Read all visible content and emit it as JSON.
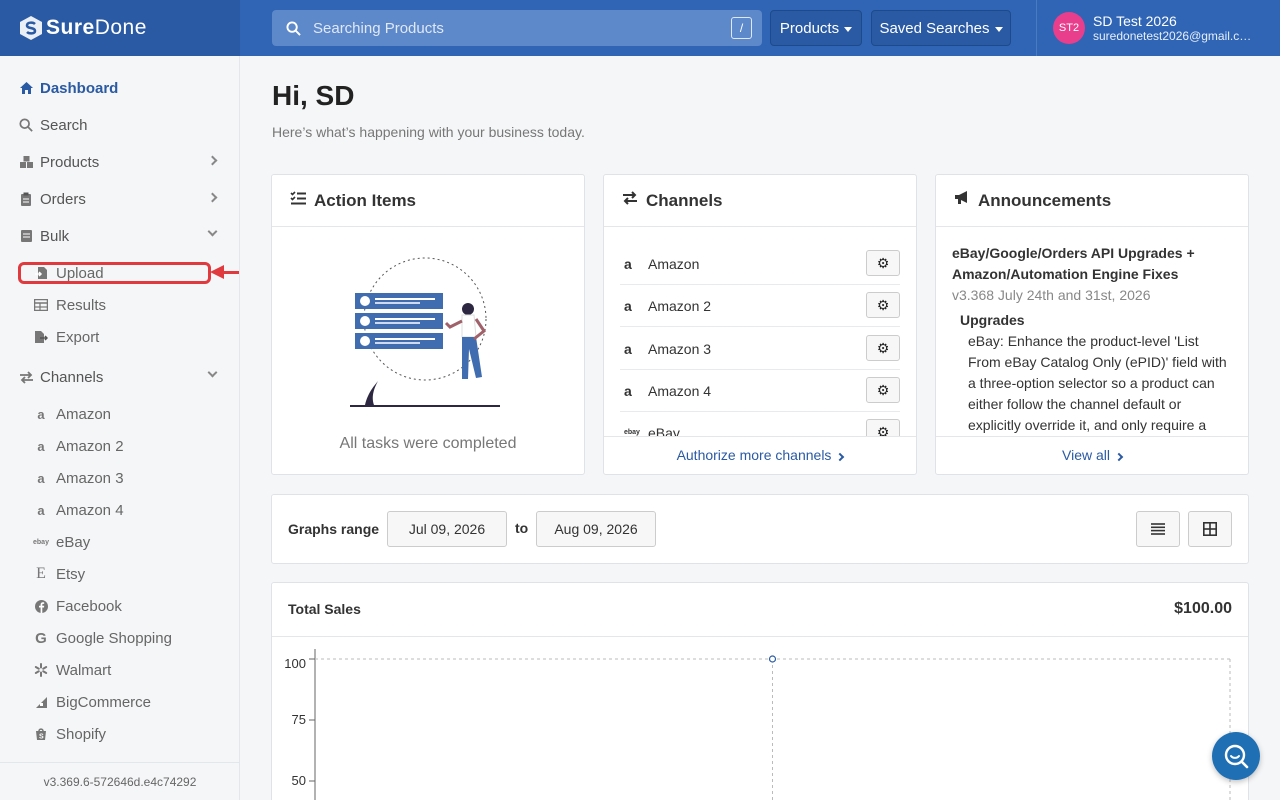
{
  "brand": {
    "name_part1": "Sure",
    "name_part2": "Done"
  },
  "header": {
    "search_placeholder": "Searching Products",
    "search_shortcut": "/",
    "products_button": "Products",
    "saved_searches_button": "Saved Searches",
    "user": {
      "initials": "ST2",
      "name": "SD Test 2026",
      "email": "suredonetest2026@gmail.com"
    }
  },
  "sidebar": {
    "items": [
      {
        "label": "Dashboard",
        "icon": "home-icon",
        "active": true
      },
      {
        "label": "Search",
        "icon": "search-icon"
      },
      {
        "label": "Products",
        "icon": "boxes-icon",
        "chevron": "right"
      },
      {
        "label": "Orders",
        "icon": "clipboard-icon",
        "chevron": "right"
      },
      {
        "label": "Bulk",
        "icon": "bulk-icon",
        "chevron": "down"
      }
    ],
    "bulk_sub": [
      {
        "label": "Upload",
        "icon": "file-import-icon"
      },
      {
        "label": "Results",
        "icon": "table-icon"
      },
      {
        "label": "Export",
        "icon": "file-export-icon"
      }
    ],
    "channels_header": {
      "label": "Channels",
      "icon": "exchange-icon",
      "chevron": "down"
    },
    "channels": [
      {
        "label": "Amazon",
        "icon": "amazon-icon"
      },
      {
        "label": "Amazon 2",
        "icon": "amazon-icon"
      },
      {
        "label": "Amazon 3",
        "icon": "amazon-icon"
      },
      {
        "label": "Amazon 4",
        "icon": "amazon-icon"
      },
      {
        "label": "eBay",
        "icon": "ebay-icon"
      },
      {
        "label": "Etsy",
        "icon": "etsy-icon"
      },
      {
        "label": "Facebook",
        "icon": "facebook-icon"
      },
      {
        "label": "Google Shopping",
        "icon": "google-icon"
      },
      {
        "label": "Walmart",
        "icon": "walmart-icon"
      },
      {
        "label": "BigCommerce",
        "icon": "bigcommerce-icon"
      },
      {
        "label": "Shopify",
        "icon": "shopify-icon"
      }
    ],
    "version": "v3.369.6-572646d.e4c74292"
  },
  "main": {
    "greeting": "Hi, SD",
    "subtitle": "Here’s what’s happening with your business today."
  },
  "action_items": {
    "title": "Action Items",
    "empty_text": "All tasks were completed"
  },
  "channels_card": {
    "title": "Channels",
    "rows": [
      "Amazon",
      "Amazon 2",
      "Amazon 3",
      "Amazon 4",
      "eBay"
    ],
    "footer": "Authorize more channels"
  },
  "announcements": {
    "title": "Announcements",
    "headline": "eBay/Google/Orders API Upgrades + Amazon/Automation Engine Fixes",
    "date": "v3.368 July 24th and 31st, 2026",
    "section": "Upgrades",
    "body": "eBay: Enhance the product-level 'List From eBay Catalog Only (ePID)' field with a three-option selector so a product can either follow the channel default or explicitly override it, and only require a",
    "footer": "View all"
  },
  "graphs_range": {
    "label": "Graphs range",
    "from": "Jul 09, 2026",
    "to_label": "to",
    "to": "Aug 09, 2026"
  },
  "total_sales": {
    "title": "Total Sales",
    "total": "$100.00",
    "chart_data": {
      "type": "line",
      "y_ticks": [
        "100",
        "75",
        "50"
      ],
      "ylim": [
        0,
        100
      ],
      "points": [
        {
          "x_fraction": 0.5,
          "y": 100
        }
      ]
    }
  }
}
